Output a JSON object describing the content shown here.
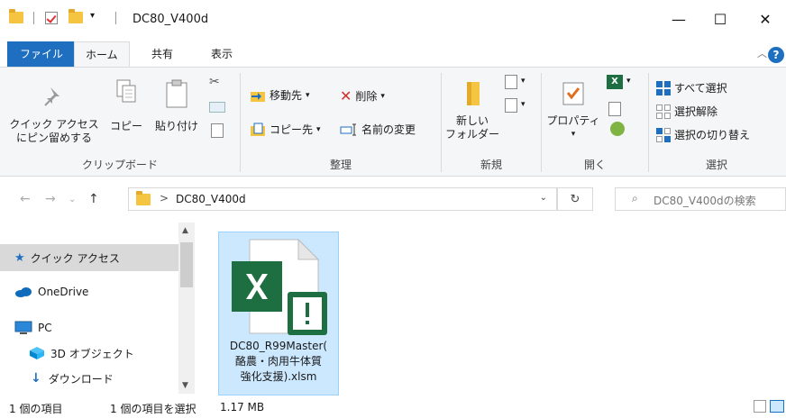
{
  "window": {
    "title": "DC80_V400d",
    "minimize": "—",
    "maximize": "☐",
    "close": "✕"
  },
  "tabs": {
    "file": "ファイル",
    "home": "ホーム",
    "share": "共有",
    "view": "表示"
  },
  "ribbon": {
    "clipboard": {
      "pin_line1": "クイック アクセス",
      "pin_line2": "にピン留めする",
      "copy": "コピー",
      "paste": "貼り付け",
      "label": "クリップボード"
    },
    "organize": {
      "move_to": "移動先",
      "copy_to": "コピー先",
      "delete": "削除",
      "rename": "名前の変更",
      "label": "整理"
    },
    "new": {
      "new_folder_line1": "新しい",
      "new_folder_line2": "フォルダー",
      "label": "新規"
    },
    "open": {
      "properties": "プロパティ",
      "label": "開く"
    },
    "select": {
      "select_all": "すべて選択",
      "select_none": "選択解除",
      "invert": "選択の切り替え",
      "label": "選択"
    }
  },
  "address": {
    "path": "DC80_V400d",
    "separator": ">",
    "search_placeholder": "DC80_V400dの検索"
  },
  "nav": {
    "items": [
      {
        "label": "クイック アクセス"
      },
      {
        "label": "OneDrive"
      },
      {
        "label": "PC"
      },
      {
        "label": "3D オブジェクト"
      },
      {
        "label": "ダウンロード"
      }
    ]
  },
  "files": [
    {
      "line1": "DC80_R99Master(",
      "line2": "酪農・肉用牛体質",
      "line3": "強化支援).xlsm"
    }
  ],
  "status": {
    "count": "1 個の項目",
    "selected": "1 個の項目を選択",
    "size": "1.17 MB"
  },
  "colors": {
    "accent": "#1e6fbf",
    "excel_green": "#1d6f42",
    "selection": "#cce8ff",
    "folder": "#f5c542"
  }
}
